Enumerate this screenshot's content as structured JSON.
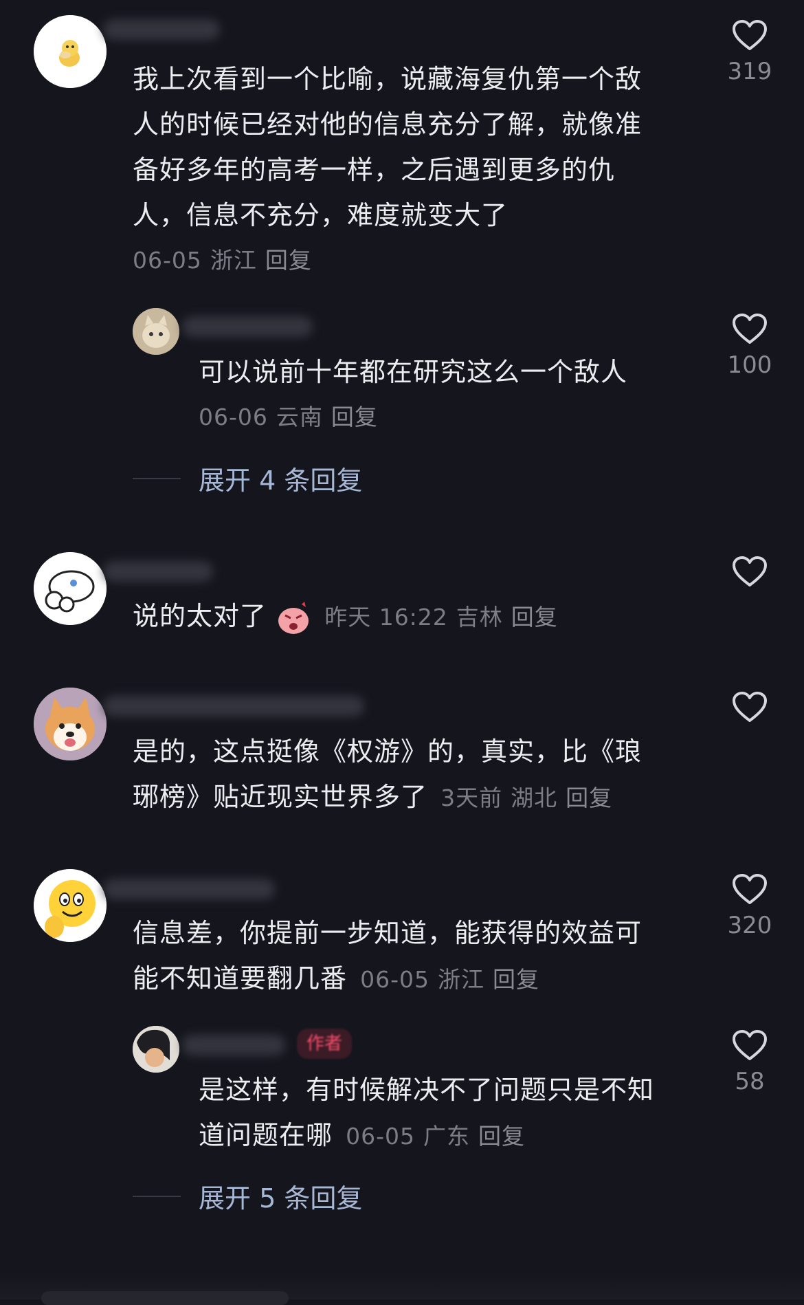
{
  "comments": [
    {
      "text": "我上次看到一个比喻，说藏海复仇第一个敌人的时候已经对他的信息充分了解，就像准备好多年的高考一样，之后遇到更多的仇人，信息不充分，难度就变大了",
      "lines": [
        "我上次看到一个比喻，说藏海复仇第一个敌",
        "人的时候已经对他的信息充分了解，就像准",
        "备好多年的高考一样，之后遇到更多的仇",
        "人，信息不充分，难度就变大了"
      ],
      "date": "06-05",
      "location": "浙江",
      "reply_label": "回复",
      "likes": "319",
      "avatar_icon": "psyduck-avatar-icon",
      "replies": [
        {
          "text": "可以说前十年都在研究这么一个敌人",
          "date": "06-06",
          "location": "云南",
          "reply_label": "回复",
          "likes": "100",
          "avatar_icon": "cat-avatar-icon"
        }
      ],
      "expand_label": "展开 4 条回复"
    },
    {
      "text": "说的太对了",
      "sticker_icon": "angry-sticker-icon",
      "date": "昨天 16:22",
      "location": "吉林",
      "reply_label": "回复",
      "likes": "",
      "avatar_icon": "cartoon-dog-avatar-icon"
    },
    {
      "lines": [
        "是的，这点挺像《权游》的，真实，比《琅",
        "琊榜》贴近现实世界多了"
      ],
      "date": "3天前",
      "location": "湖北",
      "reply_label": "回复",
      "likes": "",
      "avatar_icon": "shiba-avatar-icon"
    },
    {
      "lines": [
        "信息差，你提前一步知道，能获得的效益可",
        "能不知道要翻几番"
      ],
      "date": "06-05",
      "location": "浙江",
      "reply_label": "回复",
      "likes": "320",
      "avatar_icon": "smiley-emoji-avatar-icon",
      "replies": [
        {
          "author_badge": "作者",
          "lines": [
            "是这样，有时候解决不了问题只是不知",
            "道问题在哪"
          ],
          "date": "06-05",
          "location": "广东",
          "reply_label": "回复",
          "likes": "58",
          "avatar_icon": "person-avatar-icon"
        }
      ],
      "expand_label": "展开 5 条回复"
    }
  ],
  "colors": {
    "background": "#15151d",
    "text": "#ececf1",
    "meta": "#7d7d86",
    "expand": "#a7b8d6",
    "author_badge": "#ff4d6d"
  }
}
